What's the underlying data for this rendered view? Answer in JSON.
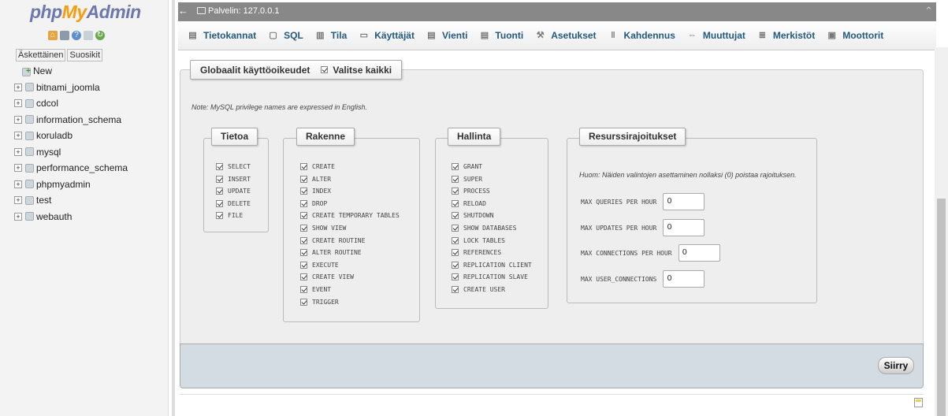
{
  "sidebar": {
    "logo": {
      "php": "php",
      "my": "My",
      "admin": "Admin"
    },
    "tabs": [
      "Äskettäinen",
      "Suosikit"
    ],
    "new_label": "New",
    "databases": [
      "bitnami_joomla",
      "cdcol",
      "information_schema",
      "koruladb",
      "mysql",
      "performance_schema",
      "phpmyadmin",
      "test",
      "webauth"
    ]
  },
  "topbar": {
    "server_label": "Palvelin: 127.0.0.1"
  },
  "menu": [
    {
      "label": "Tietokannat",
      "icon": "database-icon"
    },
    {
      "label": "SQL",
      "icon": "sql-icon"
    },
    {
      "label": "Tila",
      "icon": "status-icon"
    },
    {
      "label": "Käyttäjät",
      "icon": "users-icon"
    },
    {
      "label": "Vienti",
      "icon": "export-icon"
    },
    {
      "label": "Tuonti",
      "icon": "import-icon"
    },
    {
      "label": "Asetukset",
      "icon": "wrench-icon"
    },
    {
      "label": "Kahdennus",
      "icon": "replication-icon"
    },
    {
      "label": "Muuttujat",
      "icon": "variables-icon"
    },
    {
      "label": "Merkistöt",
      "icon": "charset-icon"
    },
    {
      "label": "Moottorit",
      "icon": "engines-icon"
    }
  ],
  "privileges": {
    "legend": "Globaalit käyttöoikeudet",
    "select_all": "Valitse kaikki",
    "note": "Note: MySQL privilege names are expressed in English.",
    "data": {
      "title": "Tietoa",
      "items": [
        "SELECT",
        "INSERT",
        "UPDATE",
        "DELETE",
        "FILE"
      ]
    },
    "structure": {
      "title": "Rakenne",
      "items": [
        "CREATE",
        "ALTER",
        "INDEX",
        "DROP",
        "CREATE TEMPORARY TABLES",
        "SHOW VIEW",
        "CREATE ROUTINE",
        "ALTER ROUTINE",
        "EXECUTE",
        "CREATE VIEW",
        "EVENT",
        "TRIGGER"
      ]
    },
    "admin": {
      "title": "Hallinta",
      "items": [
        "GRANT",
        "SUPER",
        "PROCESS",
        "RELOAD",
        "SHUTDOWN",
        "SHOW DATABASES",
        "LOCK TABLES",
        "REFERENCES",
        "REPLICATION CLIENT",
        "REPLICATION SLAVE",
        "CREATE USER"
      ]
    },
    "resources": {
      "title": "Resurssirajoitukset",
      "note": "Huom: Näiden valintojen asettaminen nollaksi (0) poistaa rajoituksen.",
      "rows": [
        {
          "label": "MAX QUERIES PER HOUR",
          "value": "0"
        },
        {
          "label": "MAX UPDATES PER HOUR",
          "value": "0"
        },
        {
          "label": "MAX CONNECTIONS PER HOUR",
          "value": "0"
        },
        {
          "label": "MAX USER_CONNECTIONS",
          "value": "0"
        }
      ]
    }
  },
  "go_button": "Siirry"
}
